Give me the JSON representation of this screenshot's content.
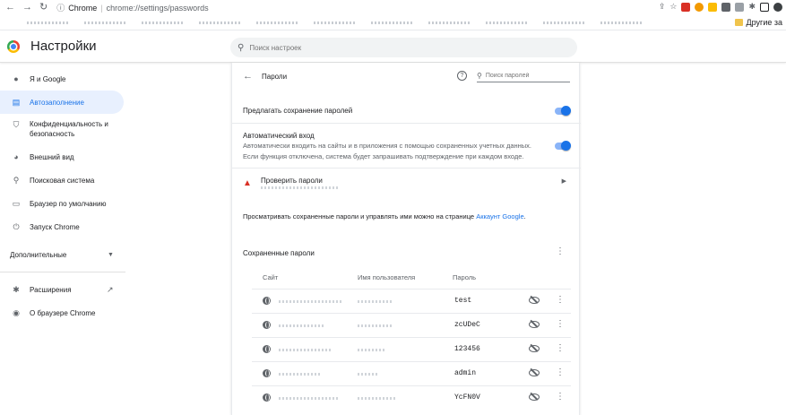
{
  "browser": {
    "tab_label": "Chrome",
    "url": "chrome://settings/passwords",
    "bookmark_folder": "Другие за"
  },
  "header": {
    "title": "Настройки",
    "search_placeholder": "Поиск настроек"
  },
  "sidebar": {
    "items": [
      {
        "label": "Я и Google",
        "icon": "person-icon"
      },
      {
        "label": "Автозаполнение",
        "icon": "autofill-icon",
        "active": true
      },
      {
        "label": "Конфиденциальность и безопасность",
        "icon": "shield-icon"
      },
      {
        "label": "Внешний вид",
        "icon": "palette-icon"
      },
      {
        "label": "Поисковая система",
        "icon": "search-icon"
      },
      {
        "label": "Браузер по умолчанию",
        "icon": "browser-icon"
      },
      {
        "label": "Запуск Chrome",
        "icon": "power-icon"
      }
    ],
    "section_label": "Дополнительные",
    "extensions_label": "Расширения",
    "about_label": "О браузере Chrome"
  },
  "passwords": {
    "title": "Пароли",
    "search_placeholder": "Поиск паролей",
    "offer_save_label": "Предлагать сохранение паролей",
    "auto_signin_label": "Автоматический вход",
    "auto_signin_desc_1": "Автоматически входить на сайты и в приложения с помощью сохраненных учетных данных.",
    "auto_signin_desc_2": "Если функция отключена, система будет запрашивать подтверждение при каждом входе.",
    "check_label": "Проверить пароли",
    "info_text": "Просматривать сохраненные пароли и управлять ими можно на странице ",
    "info_link": "Аккаунт Google",
    "info_end": ".",
    "saved_title": "Сохраненные пароли",
    "columns": {
      "site": "Сайт",
      "username": "Имя пользователя",
      "password": "Пароль"
    },
    "rows": [
      {
        "password": "test"
      },
      {
        "password": "zcUDeC"
      },
      {
        "password": "123456"
      },
      {
        "password": "admin"
      },
      {
        "password": "YcFN0V"
      }
    ]
  },
  "colors": {
    "accent": "#1a73e8",
    "active_bg": "#e8f0fe",
    "warning": "#d93025"
  }
}
